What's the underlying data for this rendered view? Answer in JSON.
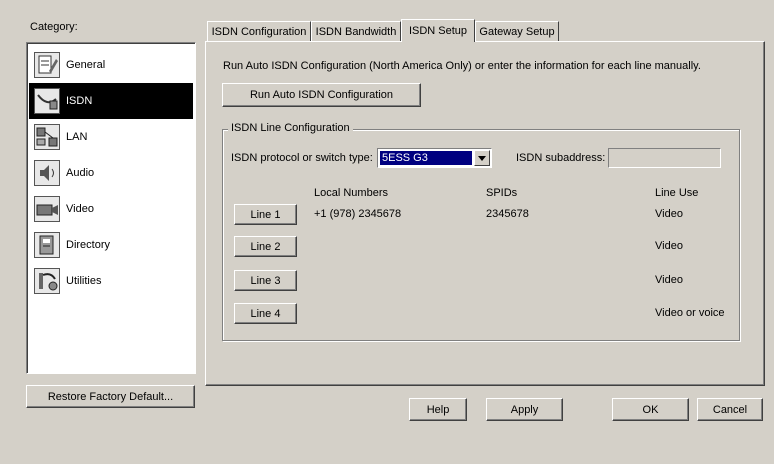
{
  "category": {
    "label": "Category:",
    "items": [
      {
        "label": "General",
        "icon": "general-icon"
      },
      {
        "label": "ISDN",
        "icon": "isdn-icon",
        "selected": true
      },
      {
        "label": "LAN",
        "icon": "lan-icon"
      },
      {
        "label": "Audio",
        "icon": "audio-icon"
      },
      {
        "label": "Video",
        "icon": "video-icon"
      },
      {
        "label": "Directory",
        "icon": "directory-icon"
      },
      {
        "label": "Utilities",
        "icon": "utilities-icon"
      }
    ],
    "restore_label": "Restore Factory Default..."
  },
  "tabs": [
    {
      "label": "ISDN Configuration"
    },
    {
      "label": "ISDN Bandwidth"
    },
    {
      "label": "ISDN Setup",
      "active": true
    },
    {
      "label": "Gateway Setup"
    }
  ],
  "setup": {
    "intro": "Run Auto ISDN Configuration (North America Only) or enter the information for each line manually.",
    "auto_button": "Run Auto ISDN Configuration",
    "group_title": "ISDN Line Configuration",
    "protocol_label": "ISDN protocol or switch type:",
    "protocol_value": "5ESS G3",
    "subaddress_label": "ISDN subaddress:",
    "subaddress_value": "",
    "columns": {
      "local": "Local Numbers",
      "spids": "SPIDs",
      "line_use": "Line Use"
    },
    "lines": [
      {
        "button": "Line 1",
        "local": "+1 (978) 2345678",
        "spid": "2345678",
        "use": "Video"
      },
      {
        "button": "Line 2",
        "local": "",
        "spid": "",
        "use": "Video"
      },
      {
        "button": "Line 3",
        "local": "",
        "spid": "",
        "use": "Video"
      },
      {
        "button": "Line 4",
        "local": "",
        "spid": "",
        "use": "Video or voice"
      }
    ]
  },
  "footer": {
    "help": "Help",
    "apply": "Apply",
    "ok": "OK",
    "cancel": "Cancel"
  }
}
